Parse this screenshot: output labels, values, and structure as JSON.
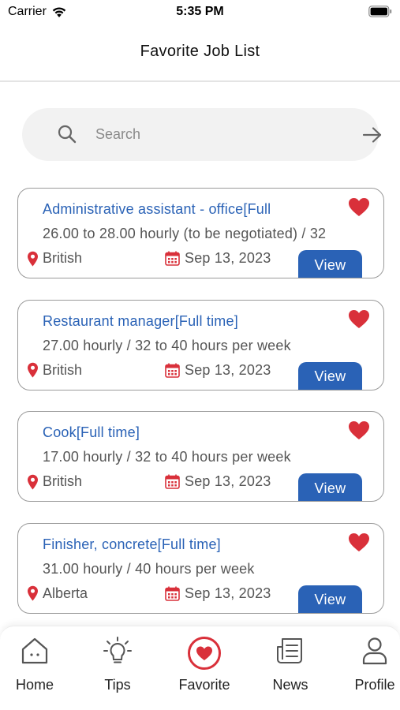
{
  "status_bar": {
    "carrier": "Carrier",
    "time": "5:35 PM"
  },
  "header": {
    "title": "Favorite Job List"
  },
  "search": {
    "placeholder": "Search"
  },
  "jobs": [
    {
      "title": "Administrative assistant - office[Full",
      "salary": "26.00 to 28.00 hourly (to be negotiated) / 32",
      "location": "British",
      "date": "Sep 13, 2023",
      "view_label": "View"
    },
    {
      "title": "Restaurant manager[Full time]",
      "salary": "27.00 hourly / 32 to 40 hours per week",
      "location": "British",
      "date": "Sep 13, 2023",
      "view_label": "View"
    },
    {
      "title": "Cook[Full time]",
      "salary": "17.00 hourly / 32 to 40 hours per week",
      "location": "British",
      "date": "Sep 13, 2023",
      "view_label": "View"
    },
    {
      "title": "Finisher, concrete[Full time]",
      "salary": "31.00 hourly / 40 hours per week",
      "location": "Alberta",
      "date": "Sep 13, 2023",
      "view_label": "View"
    }
  ],
  "tabs": [
    {
      "label": "Home",
      "icon": "home-icon"
    },
    {
      "label": "Tips",
      "icon": "lightbulb-icon"
    },
    {
      "label": "Favorite",
      "icon": "heart-circle-icon",
      "active": true
    },
    {
      "label": "News",
      "icon": "news-icon"
    },
    {
      "label": "Profile",
      "icon": "profile-icon"
    }
  ],
  "colors": {
    "accent_blue": "#2a62b6",
    "heart_red": "#d9303a",
    "card_border": "#9a9a9a",
    "search_bg": "#f2f2f2"
  }
}
